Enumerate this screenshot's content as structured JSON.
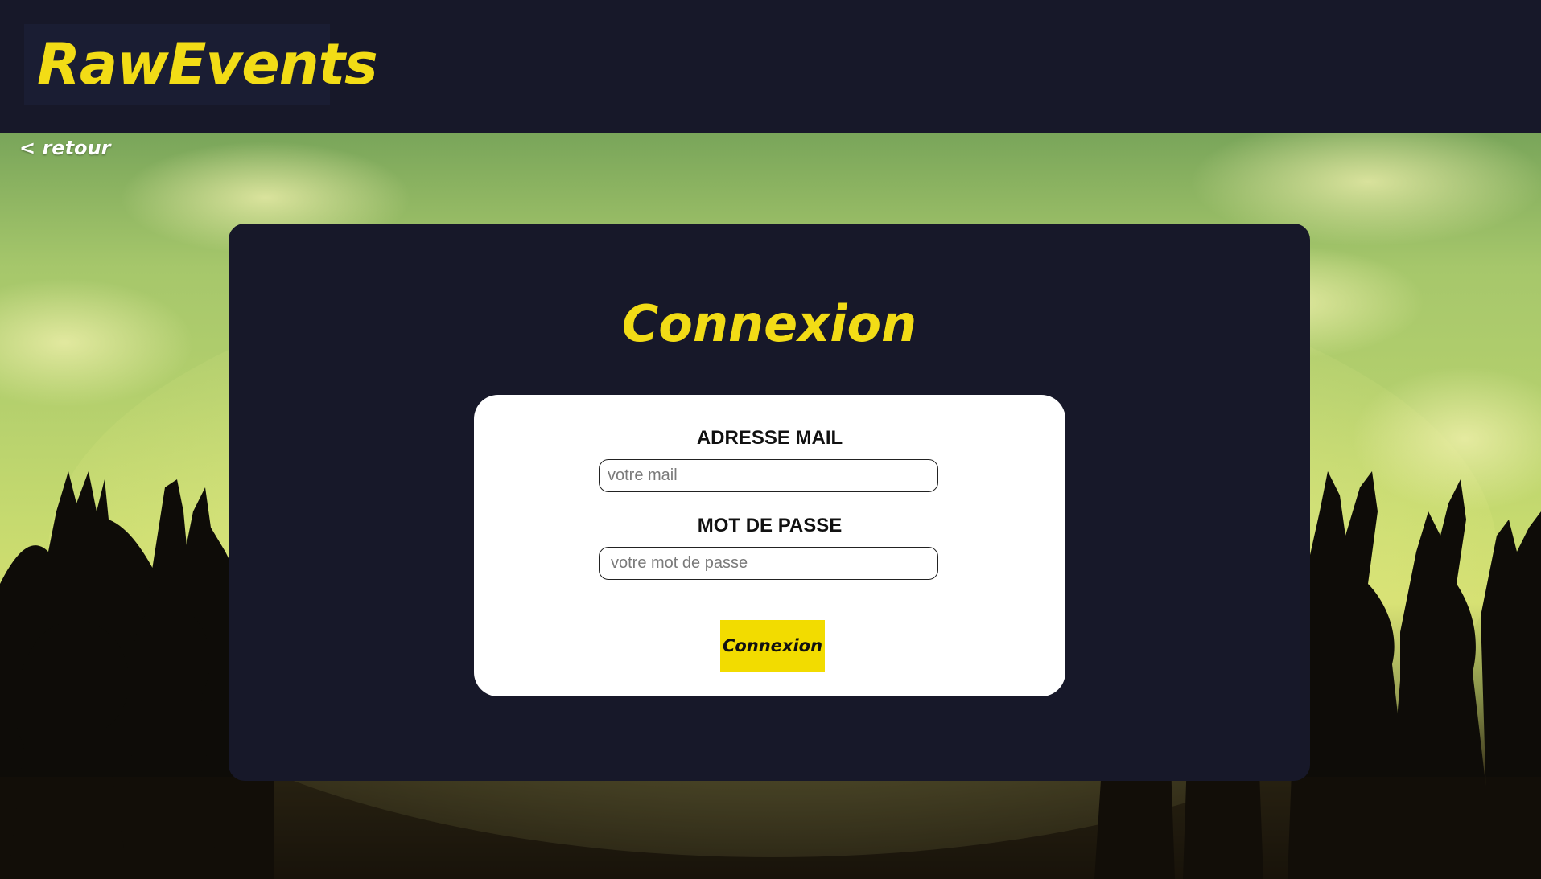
{
  "header": {
    "logo_text": "RawEvents"
  },
  "nav": {
    "back_label": "< retour"
  },
  "login": {
    "title": "Connexion",
    "email_label": "ADRESSE MAIL",
    "email_placeholder": "votre mail",
    "email_value": "",
    "password_label": "MOT DE PASSE",
    "password_placeholder": "votre mot de passe",
    "password_value": "",
    "submit_label": "Connexion"
  },
  "colors": {
    "brand_yellow": "#f2dc16",
    "button_yellow": "#f2dc00",
    "navy": "#171829",
    "card_white": "#ffffff"
  }
}
